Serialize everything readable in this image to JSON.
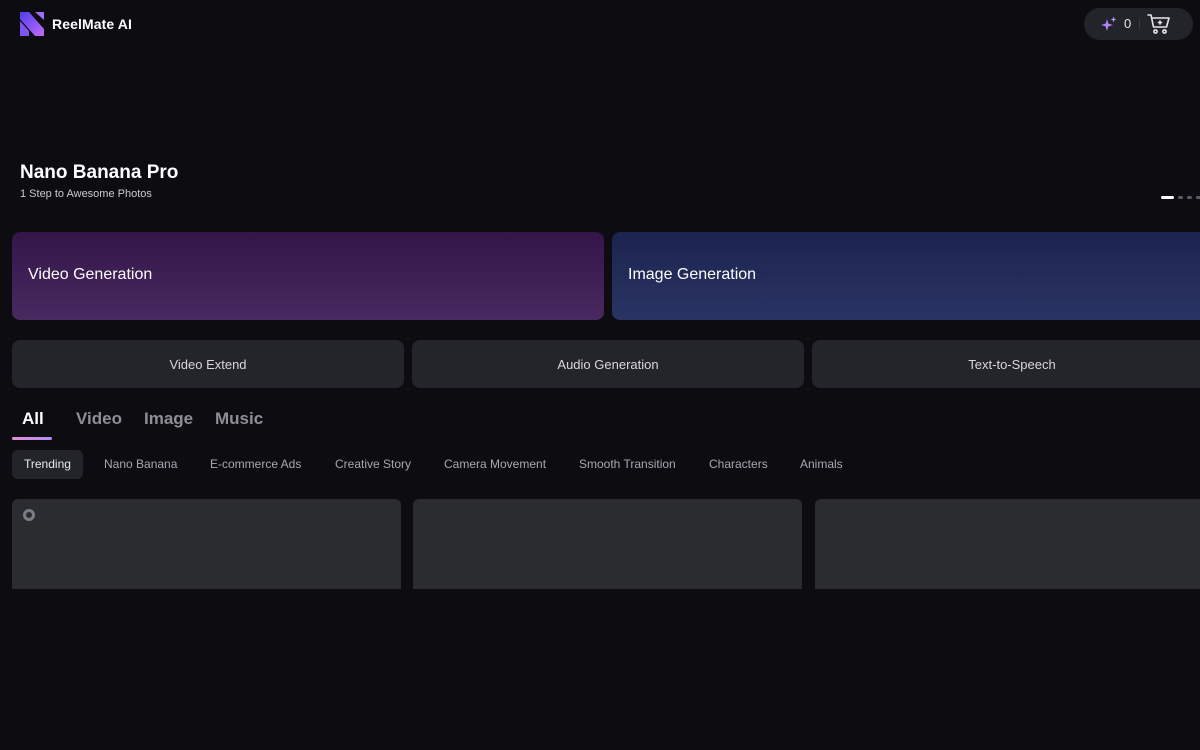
{
  "app": {
    "name": "ReelMate AI",
    "logo_icon": "reelmate-logo",
    "colors": {
      "background": "#0d0d11",
      "accent": "#b08cf3"
    }
  },
  "header": {
    "credits": "0",
    "credits_icon": "sparkle-icon",
    "cart_icon": "cart-icon"
  },
  "hero": {
    "title": "Nano Banana Pro",
    "subtitle": "1 Step to Awesome Photos",
    "slide_count": 4,
    "active_slide": 1
  },
  "generation": {
    "video": "Video Generation",
    "image": "Image Generation"
  },
  "tools": [
    "Video Extend",
    "Audio Generation",
    "Text-to-Speech"
  ],
  "tabs": [
    "All",
    "Video",
    "Image",
    "Music"
  ],
  "active_tab": "All",
  "categories": [
    "Trending",
    "Nano Banana",
    "E-commerce Ads",
    "Creative Story",
    "Camera Movement",
    "Smooth Transition",
    "Characters",
    "Animals"
  ],
  "active_category": "Trending"
}
